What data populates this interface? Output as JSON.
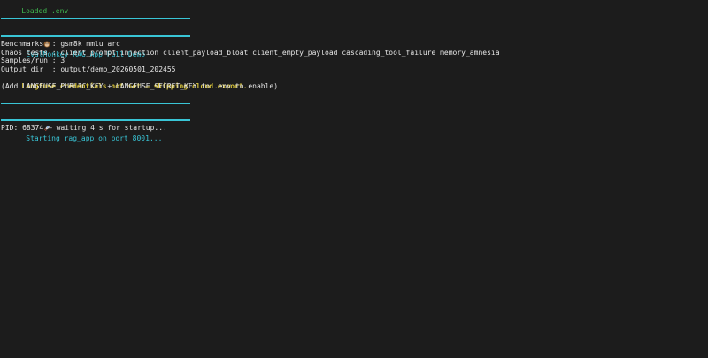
{
  "loaded_env": "Loaded .env",
  "banner": {
    "title": "EvalMonkey RAG App Full Demo",
    "icon": "monkey-icon"
  },
  "config": {
    "benchmarks": "Benchmarks  : gsm8k mmlu arc",
    "chaos_tests": "Chaos tests : client_prompt_injection client_payload_bloat client_empty_payload cascading_tool_failure memory_amnesia",
    "samples": "Samples/run : 3",
    "output_dir": "Output dir  : output/demo_20260501_202455"
  },
  "langfuse_warning": "Langfuse credentials not set — skipping cloud export.",
  "langfuse_hint": "(Add LANGFUSE_PUBLIC_KEY + LANGFUSE_SECRET_KEY to .env to enable)",
  "starting": {
    "text": "Starting rag_app on port 8001...",
    "icon": "rocket-icon"
  },
  "pid_line": "PID: 68374 — waiting 4 s for startup...",
  "colors": {
    "background": "#1c1c1c",
    "accent_cyan": "#39c5d6",
    "success_green": "#3fb950",
    "warning_yellow": "#d7c33a"
  }
}
